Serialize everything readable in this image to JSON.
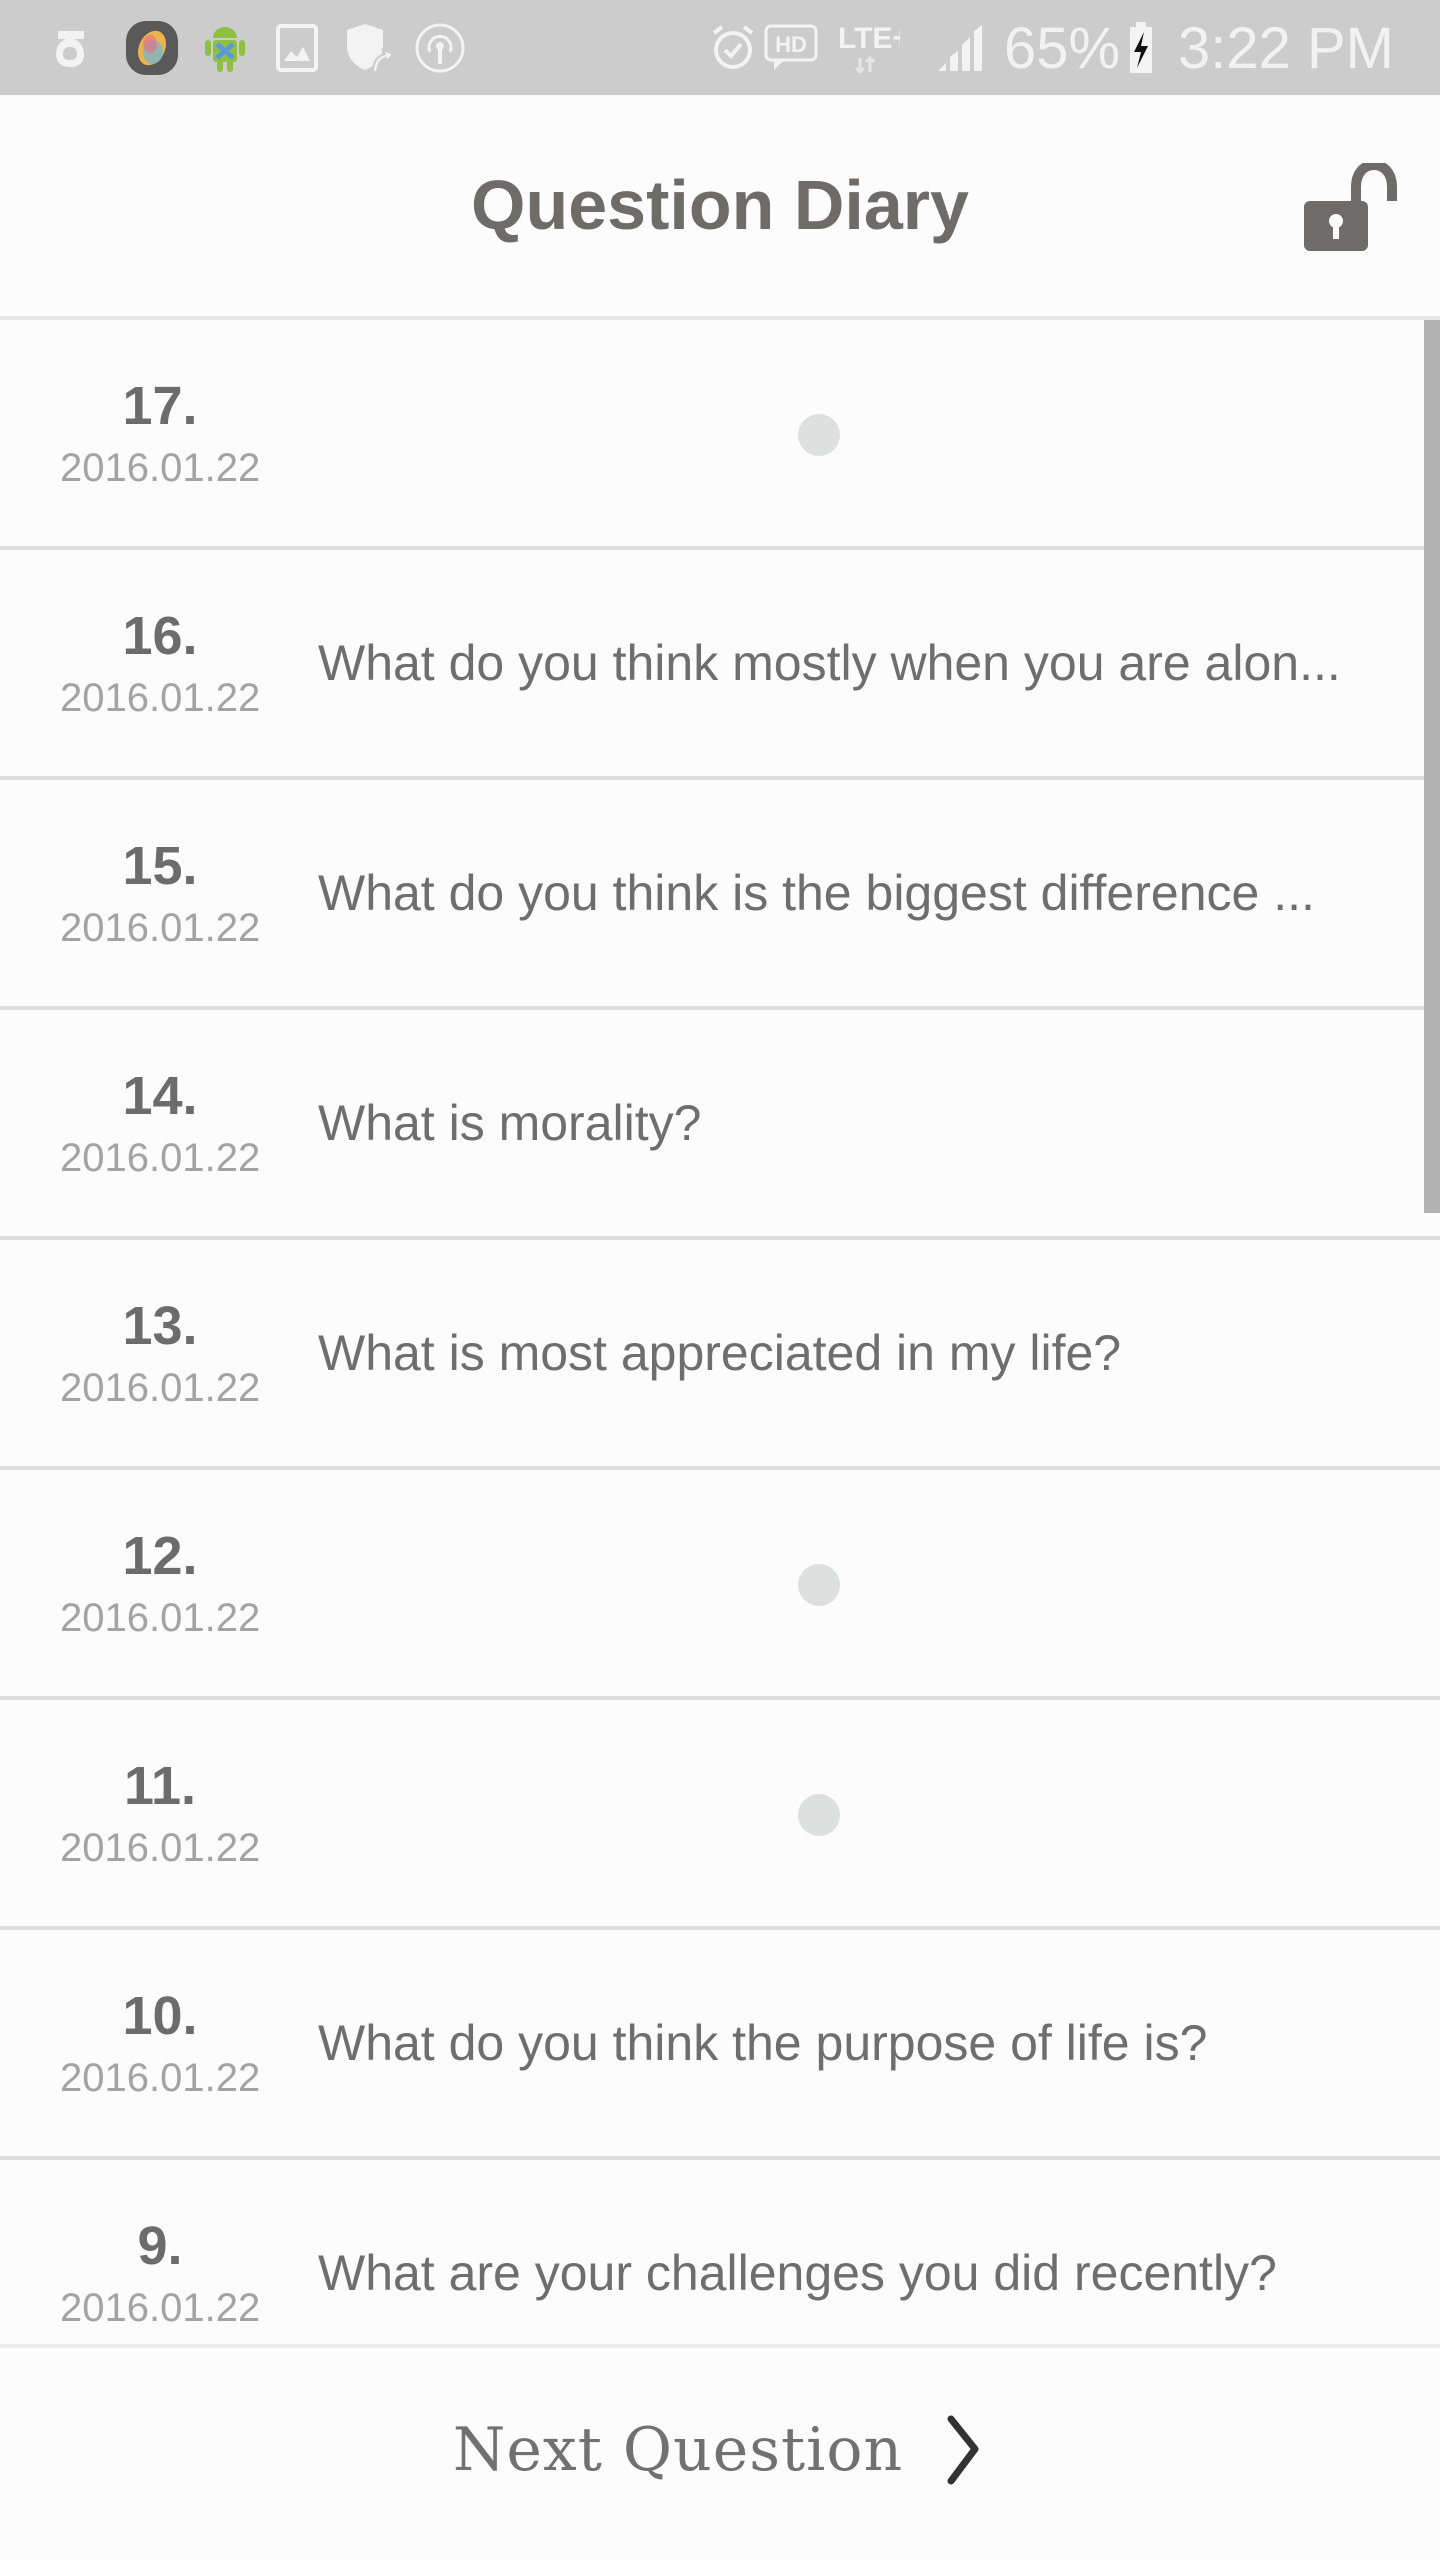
{
  "status_bar": {
    "left_icons": [
      "g-app-icon",
      "color-bean-app-icon",
      "android-debug-icon",
      "gallery-icon",
      "shield-update-icon",
      "hotspot-icon"
    ],
    "right_icons": [
      "alarm-icon",
      "hd-voice-icon",
      "lte-plus-icon",
      "signal-icon",
      "battery-charging-icon"
    ],
    "network": "LTE+",
    "hd": "HD",
    "battery": "65%",
    "time": "3:22 PM"
  },
  "header": {
    "title": "Question Diary",
    "lock_icon": "unlock-icon"
  },
  "entries": [
    {
      "number": "17.",
      "date": "2016.01.22",
      "question": "",
      "loading": true
    },
    {
      "number": "16.",
      "date": "2016.01.22",
      "question": "What do you think mostly when you are alon...",
      "loading": false
    },
    {
      "number": "15.",
      "date": "2016.01.22",
      "question": "What do you think is the biggest difference ...",
      "loading": false
    },
    {
      "number": "14.",
      "date": "2016.01.22",
      "question": "What is morality?",
      "loading": false
    },
    {
      "number": "13.",
      "date": "2016.01.22",
      "question": "What is most appreciated in my life?",
      "loading": false
    },
    {
      "number": "12.",
      "date": "2016.01.22",
      "question": "",
      "loading": true
    },
    {
      "number": "11.",
      "date": "2016.01.22",
      "question": "",
      "loading": true
    },
    {
      "number": "10.",
      "date": "2016.01.22",
      "question": "What do you think the purpose of life is?",
      "loading": false
    },
    {
      "number": "9.",
      "date": "2016.01.22",
      "question": "What are your challenges you did recently?",
      "loading": false
    }
  ],
  "footer": {
    "next_label": "Next Question"
  },
  "colors": {
    "status_bar_bg": "#cccccc",
    "title_text": "#6d6c69",
    "number_text": "#6c6c6c",
    "date_text": "#a3a3a3",
    "question_text": "#6e6e6e",
    "divider": "#dddddd"
  }
}
